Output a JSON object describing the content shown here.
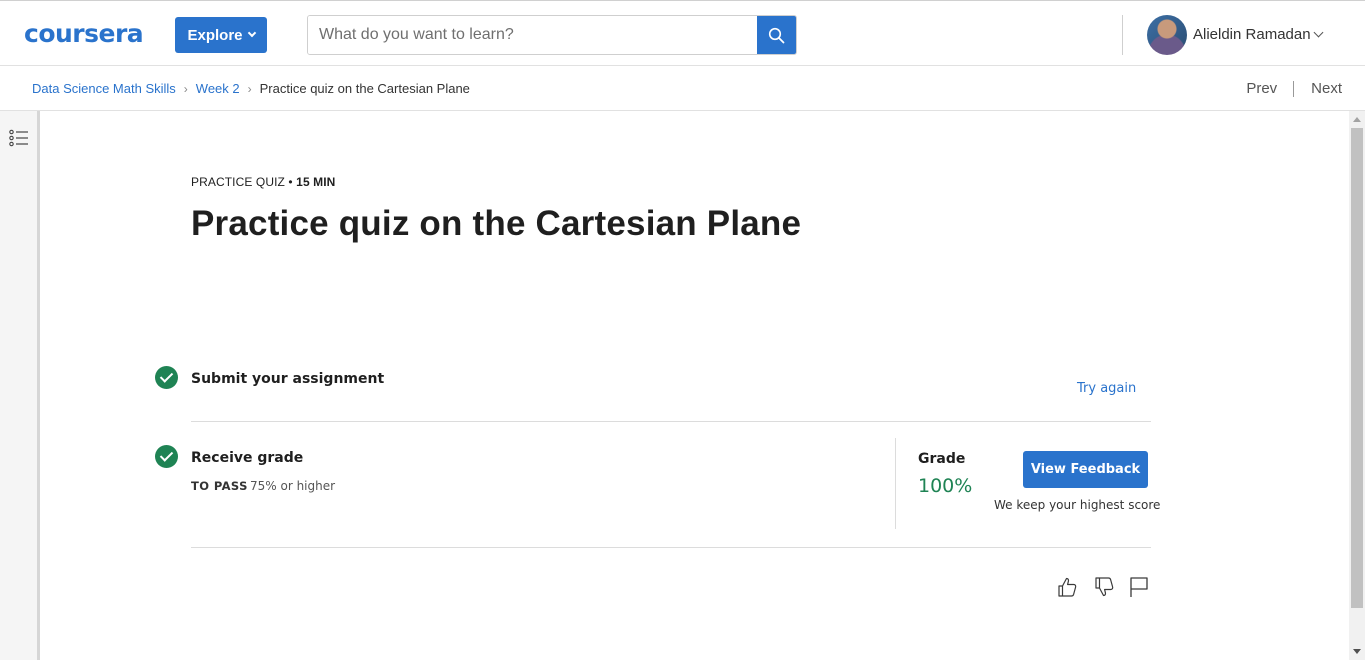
{
  "header": {
    "logo_text": "coursera",
    "explore_label": "Explore",
    "search": {
      "placeholder": "What do you want to learn?",
      "value": ""
    },
    "user": {
      "name": "Alieldin Ramadan"
    }
  },
  "breadcrumb": {
    "items": [
      "Data Science Math Skills",
      "Week 2",
      "Practice quiz on the Cartesian Plane"
    ],
    "prev_label": "Prev",
    "next_label": "Next"
  },
  "main": {
    "eyebrow_type": "PRACTICE QUIZ",
    "eyebrow_sep": "•",
    "eyebrow_time": "15 MIN",
    "title": "Practice quiz on the Cartesian Plane",
    "steps": {
      "submit": {
        "title": "Submit your assignment",
        "action": "Try again"
      },
      "grade": {
        "title": "Receive grade",
        "pass_label": "TO PASS",
        "pass_value": "75% or higher",
        "grade_label": "Grade",
        "grade_value": "100%",
        "feedback_button": "View Feedback",
        "note": "We keep your highest score"
      }
    }
  },
  "colors": {
    "brand_blue": "#2a73cc",
    "success_green": "#1f8354"
  },
  "icons": [
    "search-icon",
    "chevron-down-icon",
    "list-icon",
    "check-icon",
    "thumbs-up-icon",
    "thumbs-down-icon",
    "flag-icon"
  ]
}
